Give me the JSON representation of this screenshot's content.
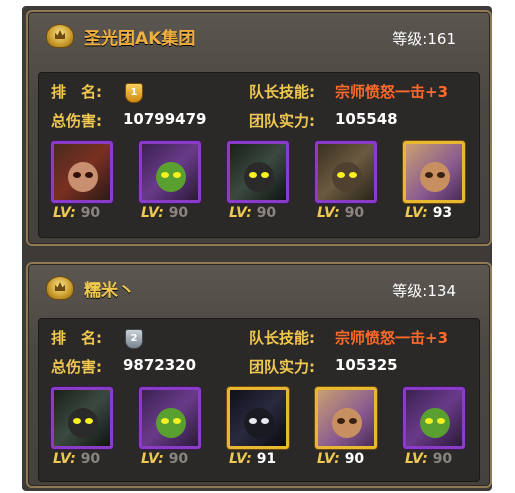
{
  "guilds": [
    {
      "name": "圣光团AK集团",
      "level_label": "等级:",
      "level": "161",
      "rank_label": "排　名:",
      "rank": "1",
      "skill_label": "队长技能:",
      "skill": "宗师愤怒一击+3",
      "damage_label": "总伤害:",
      "damage": "10799479",
      "power_label": "团队实力:",
      "power": "105548",
      "heroes": [
        {
          "lv_label": "LV:",
          "lv": "90",
          "frame": "purple",
          "theme": "red"
        },
        {
          "lv_label": "LV:",
          "lv": "90",
          "frame": "purple",
          "theme": "green"
        },
        {
          "lv_label": "LV:",
          "lv": "90",
          "frame": "purple",
          "theme": "dark"
        },
        {
          "lv_label": "LV:",
          "lv": "90",
          "frame": "purple",
          "theme": "armor"
        },
        {
          "lv_label": "LV:",
          "lv": "93",
          "frame": "gold",
          "theme": "tan"
        }
      ]
    },
    {
      "name": "糯米丶",
      "level_label": "等级:",
      "level": "134",
      "rank_label": "排　名:",
      "rank": "2",
      "skill_label": "队长技能:",
      "skill": "宗师愤怒一击+3",
      "damage_label": "总伤害:",
      "damage": "9872320",
      "power_label": "团队实力:",
      "power": "105325",
      "heroes": [
        {
          "lv_label": "LV:",
          "lv": "90",
          "frame": "purple",
          "theme": "dark"
        },
        {
          "lv_label": "LV:",
          "lv": "90",
          "frame": "purple",
          "theme": "green"
        },
        {
          "lv_label": "LV:",
          "lv": "91",
          "frame": "gold",
          "theme": "shadow"
        },
        {
          "lv_label": "LV:",
          "lv": "90",
          "frame": "gold",
          "theme": "tan"
        },
        {
          "lv_label": "LV:",
          "lv": "90",
          "frame": "purple",
          "theme": "green"
        }
      ]
    }
  ]
}
